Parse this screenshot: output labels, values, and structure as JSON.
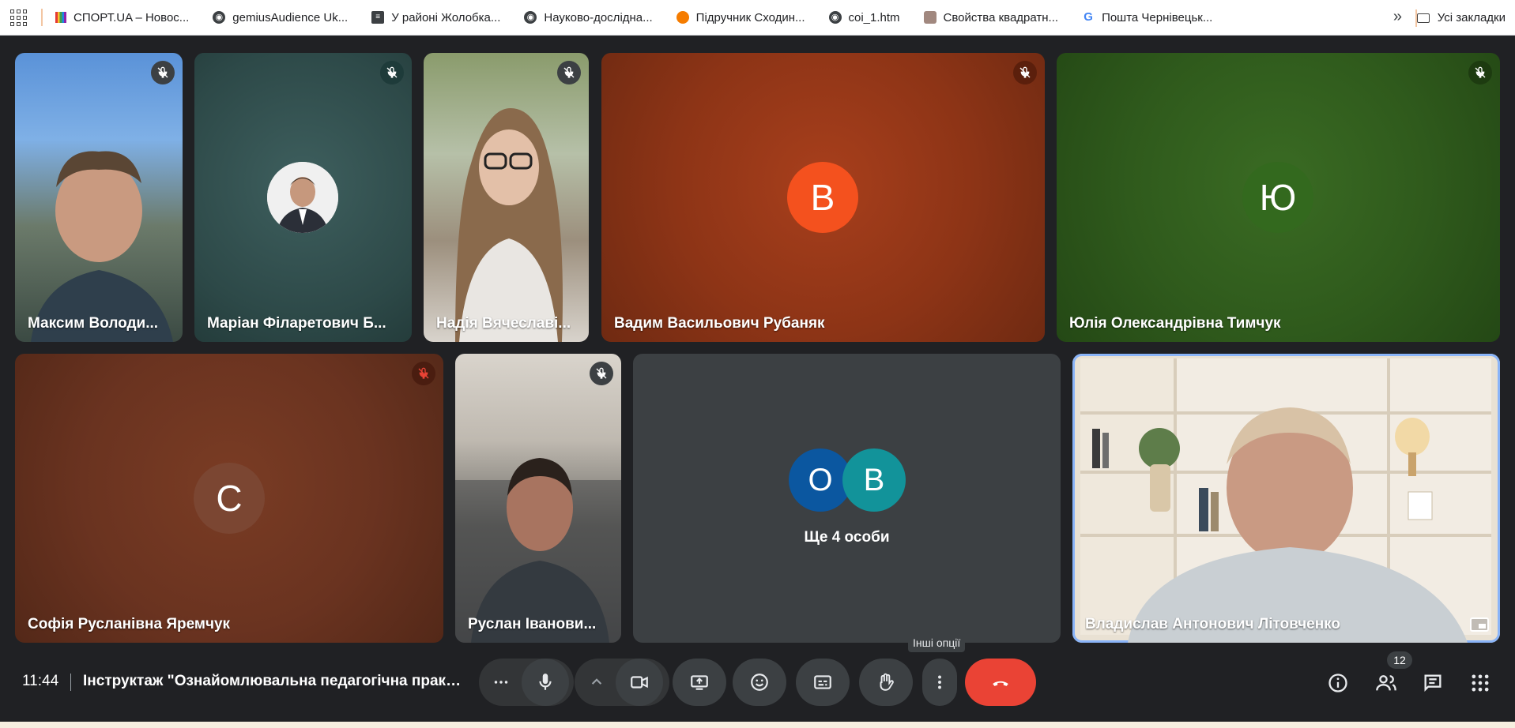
{
  "bookmarks": {
    "items": [
      {
        "label": "СПОРТ.UA – Новос...",
        "icon": "sport-icon"
      },
      {
        "label": "gemiusAudience Uk...",
        "icon": "globe-icon"
      },
      {
        "label": "У районі Жолобка...",
        "icon": "document-icon"
      },
      {
        "label": "Науково-дослідна...",
        "icon": "globe-icon"
      },
      {
        "label": "Підручник Сходин...",
        "icon": "orange-circle-icon"
      },
      {
        "label": "coi_1.htm",
        "icon": "globe-icon"
      },
      {
        "label": "Свойства квадратн...",
        "icon": "image-icon"
      },
      {
        "label": "Пошта Чернівецьк...",
        "icon": "google-icon"
      }
    ],
    "more": "»",
    "all_label": "Усі закладки"
  },
  "tiles": [
    {
      "name": "Максим Володи...",
      "muted": true
    },
    {
      "name": "Маріан Філаретович Б...",
      "muted": true
    },
    {
      "name": "Надія Вячеславі...",
      "muted": true
    },
    {
      "name": "Вадим Васильович Рубаняк",
      "muted": true,
      "initial": "В",
      "avatar_color": "#f4511e",
      "bg": "#8d3416"
    },
    {
      "name": "Юлія Олександрівна Тимчук",
      "muted": true,
      "initial": "Ю",
      "avatar_color": "#33691e",
      "bg": "#2f5a1c"
    },
    {
      "name": "Софія Русланівна Яремчук",
      "muted": true,
      "initial": "С",
      "avatar_color": "#6d3b27",
      "bg": "#6a3320"
    },
    {
      "name": "Руслан Іванови...",
      "muted": true
    },
    {
      "name": "Ще 4 особи",
      "initials": [
        "О",
        "В"
      ]
    },
    {
      "name": "Владислав Антонович Літовченко",
      "muted": false
    }
  ],
  "bottom": {
    "time": "11:44",
    "title": "Інструктаж \"Ознайомлювальна педагогічна практика\"",
    "tooltip": "Інші опції",
    "people_count": "12"
  },
  "colors": {
    "end_call": "#ea4335",
    "background": "#202124",
    "control": "#3c4043",
    "mute_badge": "#ea4335"
  }
}
